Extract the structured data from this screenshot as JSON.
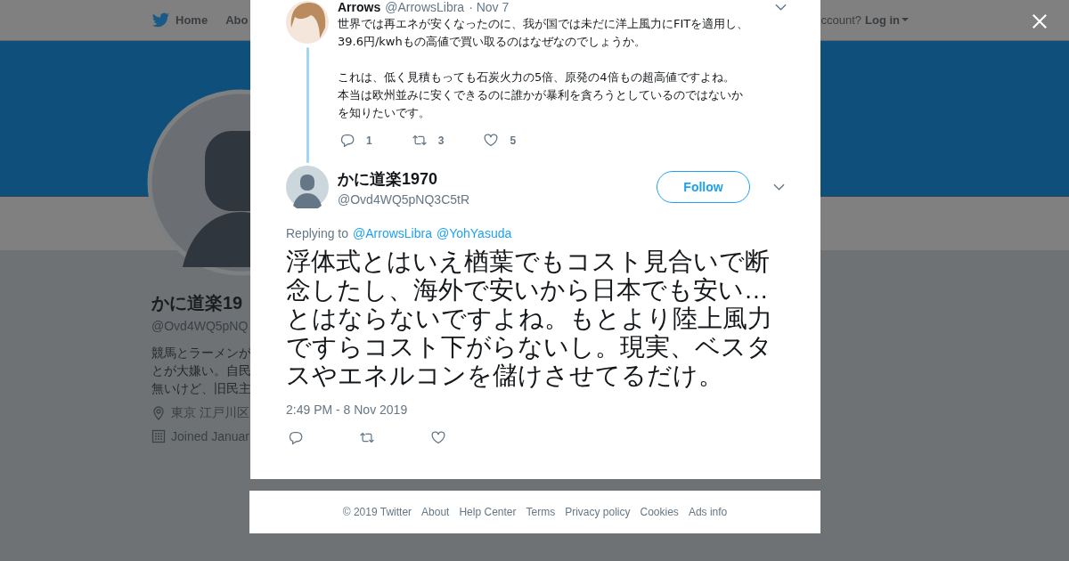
{
  "nav": {
    "home": "Home",
    "about": "Abo",
    "account": "ccount?",
    "login": "Log in"
  },
  "profile": {
    "name": "かに道楽19",
    "handle": "@Ovd4WQ5pNQ",
    "bio": [
      "競馬とラーメンが",
      "とが大嫌い。自民",
      "無いけど、旧民主"
    ],
    "location": "東京 江戸川区",
    "joined": "Joined Januar"
  },
  "parent_tweet": {
    "name": "Arrows",
    "handle": "@ArrowsLibra",
    "date": "· Nov 7",
    "paragraphs": [
      [
        "世界では再エネが安くなったのに、我が国では未だに洋上風力にFITを適用し、",
        "39.6円/kwhもの高値で買い取るのはなぜなのでしょうか。"
      ],
      [
        "これは、低く見積もっても石炭火力の5倍、原発の4倍もの超高値ですよね。",
        "本当は欧州並みに安くできるのに誰かが暴利を貪ろうとしているのではないか",
        "を知りたいです。"
      ]
    ],
    "replies": "1",
    "retweets": "3",
    "likes": "5"
  },
  "tweet": {
    "name": "かに道楽1970",
    "handle": "@Ovd4WQ5pNQ3C5tR",
    "follow": "Follow",
    "replying_label": "Replying to",
    "replying_to": [
      "@ArrowsLibra",
      "@YohYasuda"
    ],
    "text": "浮体式とはいえ楢葉でもコスト見合いで断念したし、海外で安いから日本でも安い…とはならないですよね。もとより陸上風力ですらコスト下がらないし。現実、ベスタスやエネルコンを儲けさせてるだけ。",
    "time": "2:49 PM - 8 Nov 2019"
  },
  "footer": [
    "© 2019 Twitter",
    "About",
    "Help Center",
    "Terms",
    "Privacy policy",
    "Cookies",
    "Ads info"
  ]
}
